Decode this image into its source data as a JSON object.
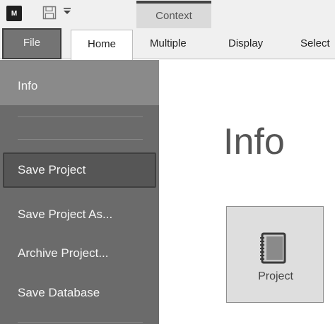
{
  "quick_access": {
    "app_icon_text": "M",
    "save_icon": "save-icon",
    "dropdown_icon": "dropdown-arrow-icon"
  },
  "ribbon": {
    "context_label": "Context",
    "tabs": [
      {
        "id": "file",
        "label": "File"
      },
      {
        "id": "home",
        "label": "Home"
      },
      {
        "id": "multiple",
        "label": "Multiple"
      },
      {
        "id": "display",
        "label": "Display"
      },
      {
        "id": "select",
        "label": "Select"
      }
    ],
    "active_tab": "home"
  },
  "backstage": {
    "items": [
      {
        "id": "info",
        "label": "Info",
        "selected": true
      },
      {
        "id": "save_project",
        "label": "Save Project",
        "focused": true
      },
      {
        "id": "save_project_as",
        "label": "Save Project As..."
      },
      {
        "id": "archive_project",
        "label": "Archive Project..."
      },
      {
        "id": "save_database",
        "label": "Save Database"
      }
    ]
  },
  "content": {
    "title": "Info",
    "tile": {
      "label": "Project",
      "icon": "notebook-icon"
    }
  },
  "colors": {
    "sidebar_bg": "#6b6b6b",
    "sidebar_selected": "#8a8a8a",
    "file_tab_bg": "#747474",
    "tile_bg": "#dedede"
  }
}
